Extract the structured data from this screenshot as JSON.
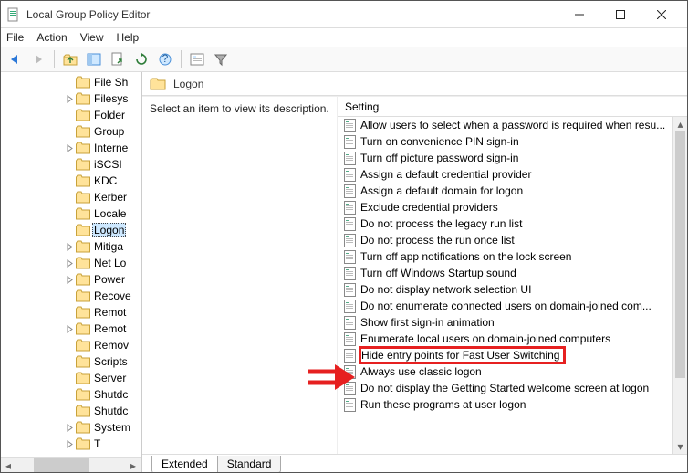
{
  "window": {
    "title": "Local Group Policy Editor"
  },
  "menu": {
    "items": [
      "File",
      "Action",
      "View",
      "Help"
    ]
  },
  "tree": {
    "items": [
      {
        "label": "File Sh",
        "expand": "none"
      },
      {
        "label": "Filesys",
        "expand": "closed"
      },
      {
        "label": "Folder",
        "expand": "none"
      },
      {
        "label": "Group",
        "expand": "none"
      },
      {
        "label": "Interne",
        "expand": "closed"
      },
      {
        "label": "iSCSI",
        "expand": "none"
      },
      {
        "label": "KDC",
        "expand": "none"
      },
      {
        "label": "Kerber",
        "expand": "none"
      },
      {
        "label": "Locale",
        "expand": "none"
      },
      {
        "label": "Logon",
        "expand": "none",
        "selected": true
      },
      {
        "label": "Mitiga",
        "expand": "closed"
      },
      {
        "label": "Net Lo",
        "expand": "closed"
      },
      {
        "label": "Power",
        "expand": "closed"
      },
      {
        "label": "Recove",
        "expand": "none"
      },
      {
        "label": "Remot",
        "expand": "none"
      },
      {
        "label": "Remot",
        "expand": "closed"
      },
      {
        "label": "Remov",
        "expand": "none"
      },
      {
        "label": "Scripts",
        "expand": "none"
      },
      {
        "label": "Server",
        "expand": "none"
      },
      {
        "label": "Shutdc",
        "expand": "none"
      },
      {
        "label": "Shutdc",
        "expand": "none"
      },
      {
        "label": "System",
        "expand": "closed"
      },
      {
        "label": "T",
        "expand": "closed",
        "cut": true
      }
    ]
  },
  "right": {
    "header": "Logon",
    "description": "Select an item to view its description.",
    "column": "Setting",
    "settings": [
      "Allow users to select when a password is required when resu...",
      "Turn on convenience PIN sign-in",
      "Turn off picture password sign-in",
      "Assign a default credential provider",
      "Assign a default domain for logon",
      "Exclude credential providers",
      "Do not process the legacy run list",
      "Do not process the run once list",
      "Turn off app notifications on the lock screen",
      "Turn off Windows Startup sound",
      "Do not display network selection UI",
      "Do not enumerate connected users on domain-joined com...",
      "Show first sign-in animation",
      "Enumerate local users on domain-joined computers",
      "Hide entry points for Fast User Switching",
      "Always use classic logon",
      "Do not display the Getting Started welcome screen at logon",
      "Run these programs at user logon"
    ],
    "highlightIndex": 14
  },
  "tabs": {
    "items": [
      "Extended",
      "Standard"
    ],
    "activeIndex": 0
  }
}
